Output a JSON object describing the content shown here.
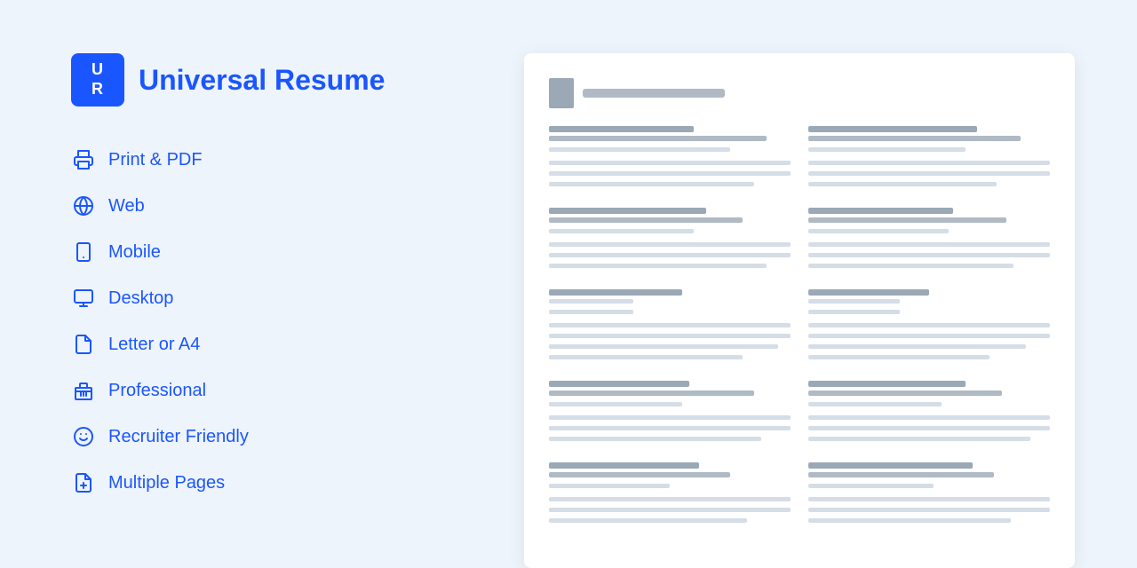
{
  "logo": {
    "line1": "U",
    "line2": "R",
    "title": "Universal Resume"
  },
  "nav": {
    "items": [
      {
        "id": "print-pdf",
        "label": "Print & PDF",
        "icon": "printer"
      },
      {
        "id": "web",
        "label": "Web",
        "icon": "globe"
      },
      {
        "id": "mobile",
        "label": "Mobile",
        "icon": "mobile"
      },
      {
        "id": "desktop",
        "label": "Desktop",
        "icon": "desktop"
      },
      {
        "id": "letter-a4",
        "label": "Letter or A4",
        "icon": "file"
      },
      {
        "id": "professional",
        "label": "Professional",
        "icon": "building"
      },
      {
        "id": "recruiter-friendly",
        "label": "Recruiter Friendly",
        "icon": "smiley"
      },
      {
        "id": "multiple-pages",
        "label": "Multiple Pages",
        "icon": "pages"
      }
    ]
  }
}
